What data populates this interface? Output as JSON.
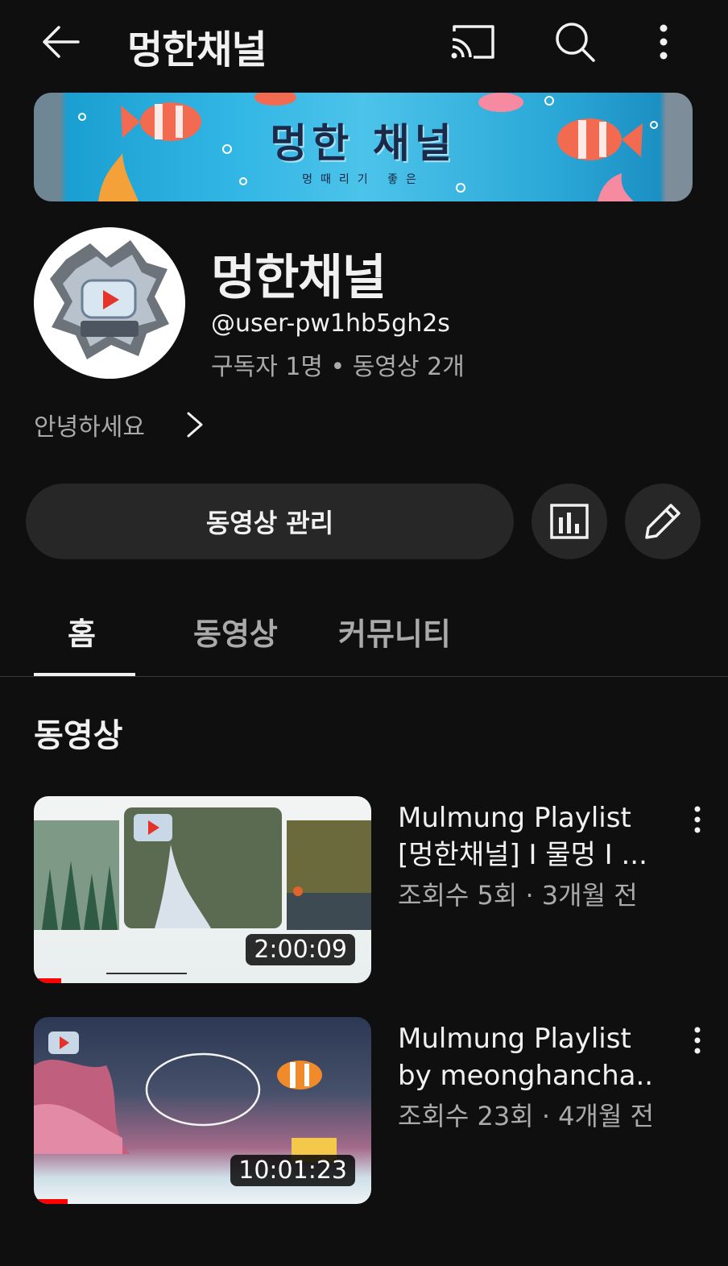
{
  "header": {
    "title": "멍한채널",
    "back_icon": "arrow-left-icon",
    "cast_icon": "cast-icon",
    "search_icon": "search-icon",
    "more_icon": "more-vertical-icon"
  },
  "banner": {
    "title": "멍한 채널",
    "subtitle": "멍때리기 좋은"
  },
  "channel": {
    "name": "멍한채널",
    "handle": "@user-pw1hb5gh2s",
    "stats": "구독자 1명 • 동영상 2개",
    "description": "안녕하세요"
  },
  "actions": {
    "manage_label": "동영상 관리",
    "analytics_icon": "analytics-icon",
    "edit_icon": "pencil-icon"
  },
  "tabs": [
    {
      "label": "홈",
      "active": true
    },
    {
      "label": "동영상",
      "active": false
    },
    {
      "label": "커뮤니티",
      "active": false
    }
  ],
  "section": {
    "title": "동영상"
  },
  "videos": [
    {
      "title_line1": "Mulmung Playlist",
      "title_line2": "[멍한채널] I 물멍 I ...",
      "meta": "조회수 5회 · 3개월 전",
      "duration": "2:00:09",
      "watched_fraction": 0.08
    },
    {
      "title_line1": "Mulmung Playlist",
      "title_line2": "by meonghancha...",
      "meta": "조회수 23회 · 4개월 전",
      "duration": "10:01:23",
      "watched_fraction": 0.1
    }
  ],
  "colors": {
    "background": "#0f0f0f",
    "surface": "#272727",
    "text_primary": "#f1f1f1",
    "text_secondary": "#aaaaaa",
    "progress": "#ff0000"
  }
}
